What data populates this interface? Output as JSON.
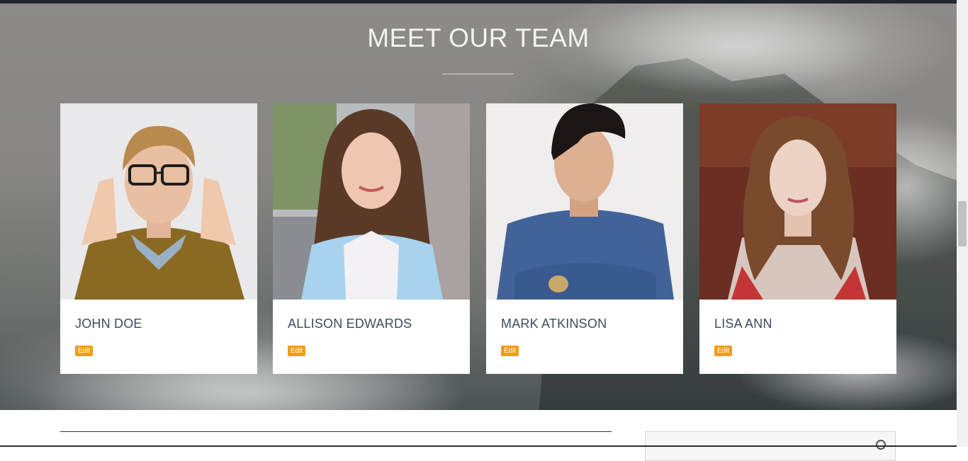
{
  "section": {
    "title": "MEET OUR TEAM"
  },
  "team": [
    {
      "name": "JOHN DOE",
      "edit_label": "Edit"
    },
    {
      "name": "ALLISON EDWARDS",
      "edit_label": "Edit"
    },
    {
      "name": "MARK ATKINSON",
      "edit_label": "Edit"
    },
    {
      "name": "LISA ANN",
      "edit_label": "Edit"
    }
  ],
  "colors": {
    "edit_badge": "#f39c12",
    "name_text": "#3f4a5c",
    "title_text": "#f2f2f2"
  },
  "icons": {
    "search": "search-icon"
  }
}
